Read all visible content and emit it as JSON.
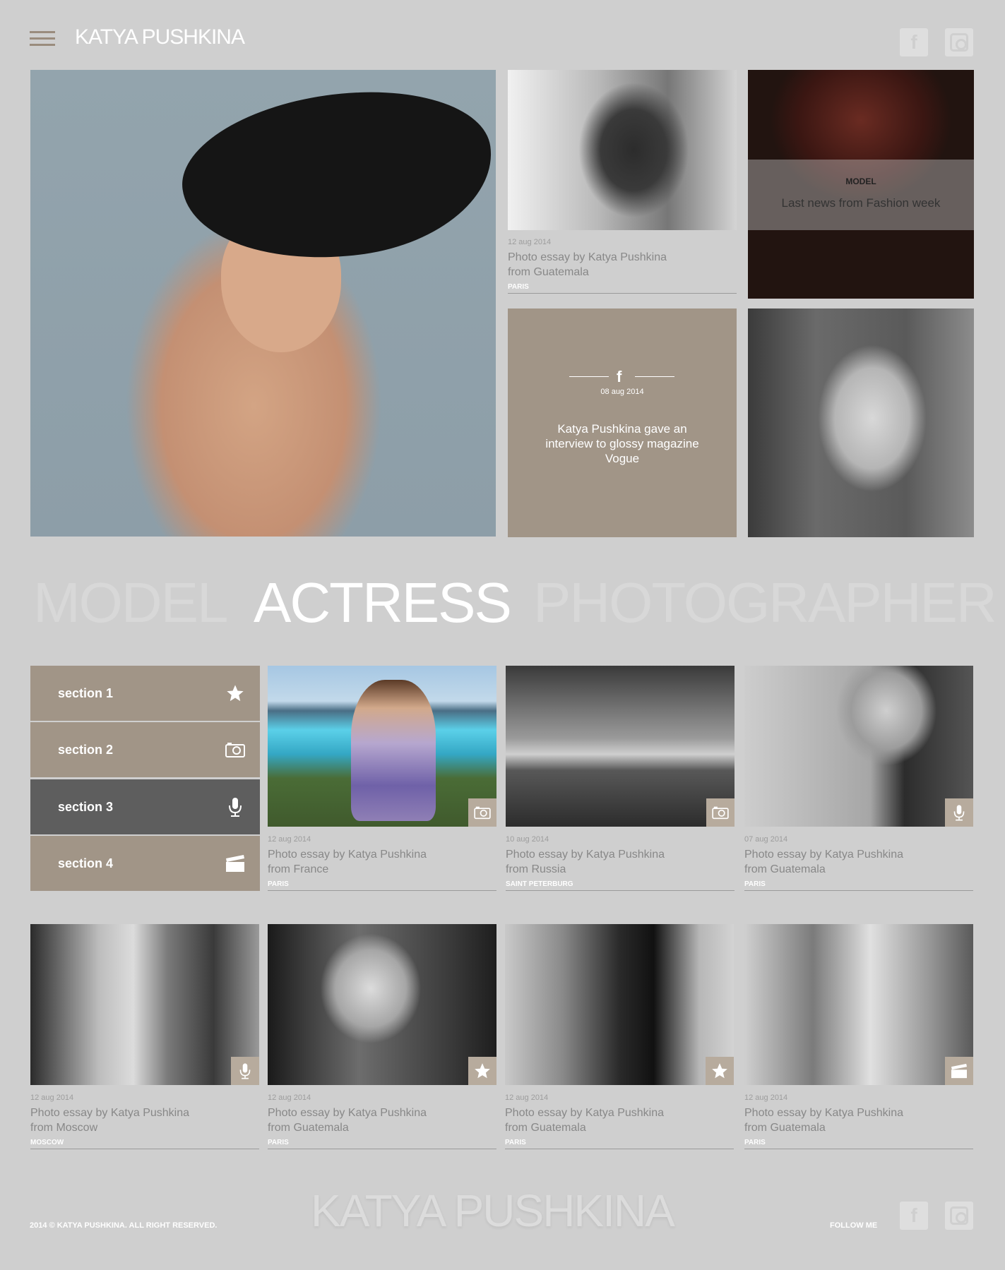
{
  "header": {
    "brand": "KATYA PUSHKINA",
    "facebook_label": "f"
  },
  "featured": {
    "man_card": {
      "date": "12 aug 2014",
      "title_line1": "Photo essay by Katya Pushkina",
      "title_line2": "from Guatemala",
      "place": "PARIS"
    },
    "turban_card": {
      "kicker": "MODEL",
      "headline": "Last news from Fashion week"
    },
    "fb_card": {
      "icon": "f",
      "date": "08 aug 2014",
      "text": "Katya Pushkina gave an interview to glossy magazine Vogue"
    }
  },
  "roles": [
    "MODEL",
    "ACTRESS",
    "PHOTOGRAPHER"
  ],
  "sections": [
    {
      "label": "section 1",
      "icon": "star-icon"
    },
    {
      "label": "section 2",
      "icon": "camera-icon"
    },
    {
      "label": "section 3",
      "icon": "microphone-icon"
    },
    {
      "label": "section 4",
      "icon": "clapperboard-icon"
    }
  ],
  "grid": [
    {
      "date": "12 aug 2014",
      "title_line1": "Photo essay by Katya Pushkina",
      "title_line2": "from France",
      "place": "PARIS",
      "badge": "camera-icon"
    },
    {
      "date": "10 aug 2014",
      "title_line1": "Photo essay by Katya Pushkina",
      "title_line2": "from Russia",
      "place": "SAINT PETERBURG",
      "badge": "camera-icon"
    },
    {
      "date": "07 aug 2014",
      "title_line1": "Photo essay by Katya Pushkina",
      "title_line2": "from Guatemala",
      "place": "PARIS",
      "badge": "microphone-icon"
    },
    {
      "date": "12 aug 2014",
      "title_line1": "Photo essay by Katya Pushkina",
      "title_line2": "from Moscow",
      "place": "MOSCOW",
      "badge": "microphone-icon"
    },
    {
      "date": "12 aug 2014",
      "title_line1": "Photo essay by Katya Pushkina",
      "title_line2": "from Guatemala",
      "place": "PARIS",
      "badge": "star-icon"
    },
    {
      "date": "12 aug 2014",
      "title_line1": "Photo essay by Katya Pushkina",
      "title_line2": "from Guatemala",
      "place": "PARIS",
      "badge": "star-icon"
    },
    {
      "date": "12 aug 2014",
      "title_line1": "Photo essay by Katya Pushkina",
      "title_line2": "from Guatemala",
      "place": "PARIS",
      "badge": "clapperboard-icon"
    }
  ],
  "footer": {
    "copyright": "2014 © KATYA PUSHKINA. ALL RIGHT RESERVED.",
    "brand": "KATYA PUSHKINA",
    "follow": "FOLLOW ME",
    "facebook_label": "f"
  },
  "colors": {
    "background": "#cfcfcf",
    "accent_taupe": "#a19587",
    "active_section": "#5e5e5e",
    "badge": "#b7ab9d"
  }
}
